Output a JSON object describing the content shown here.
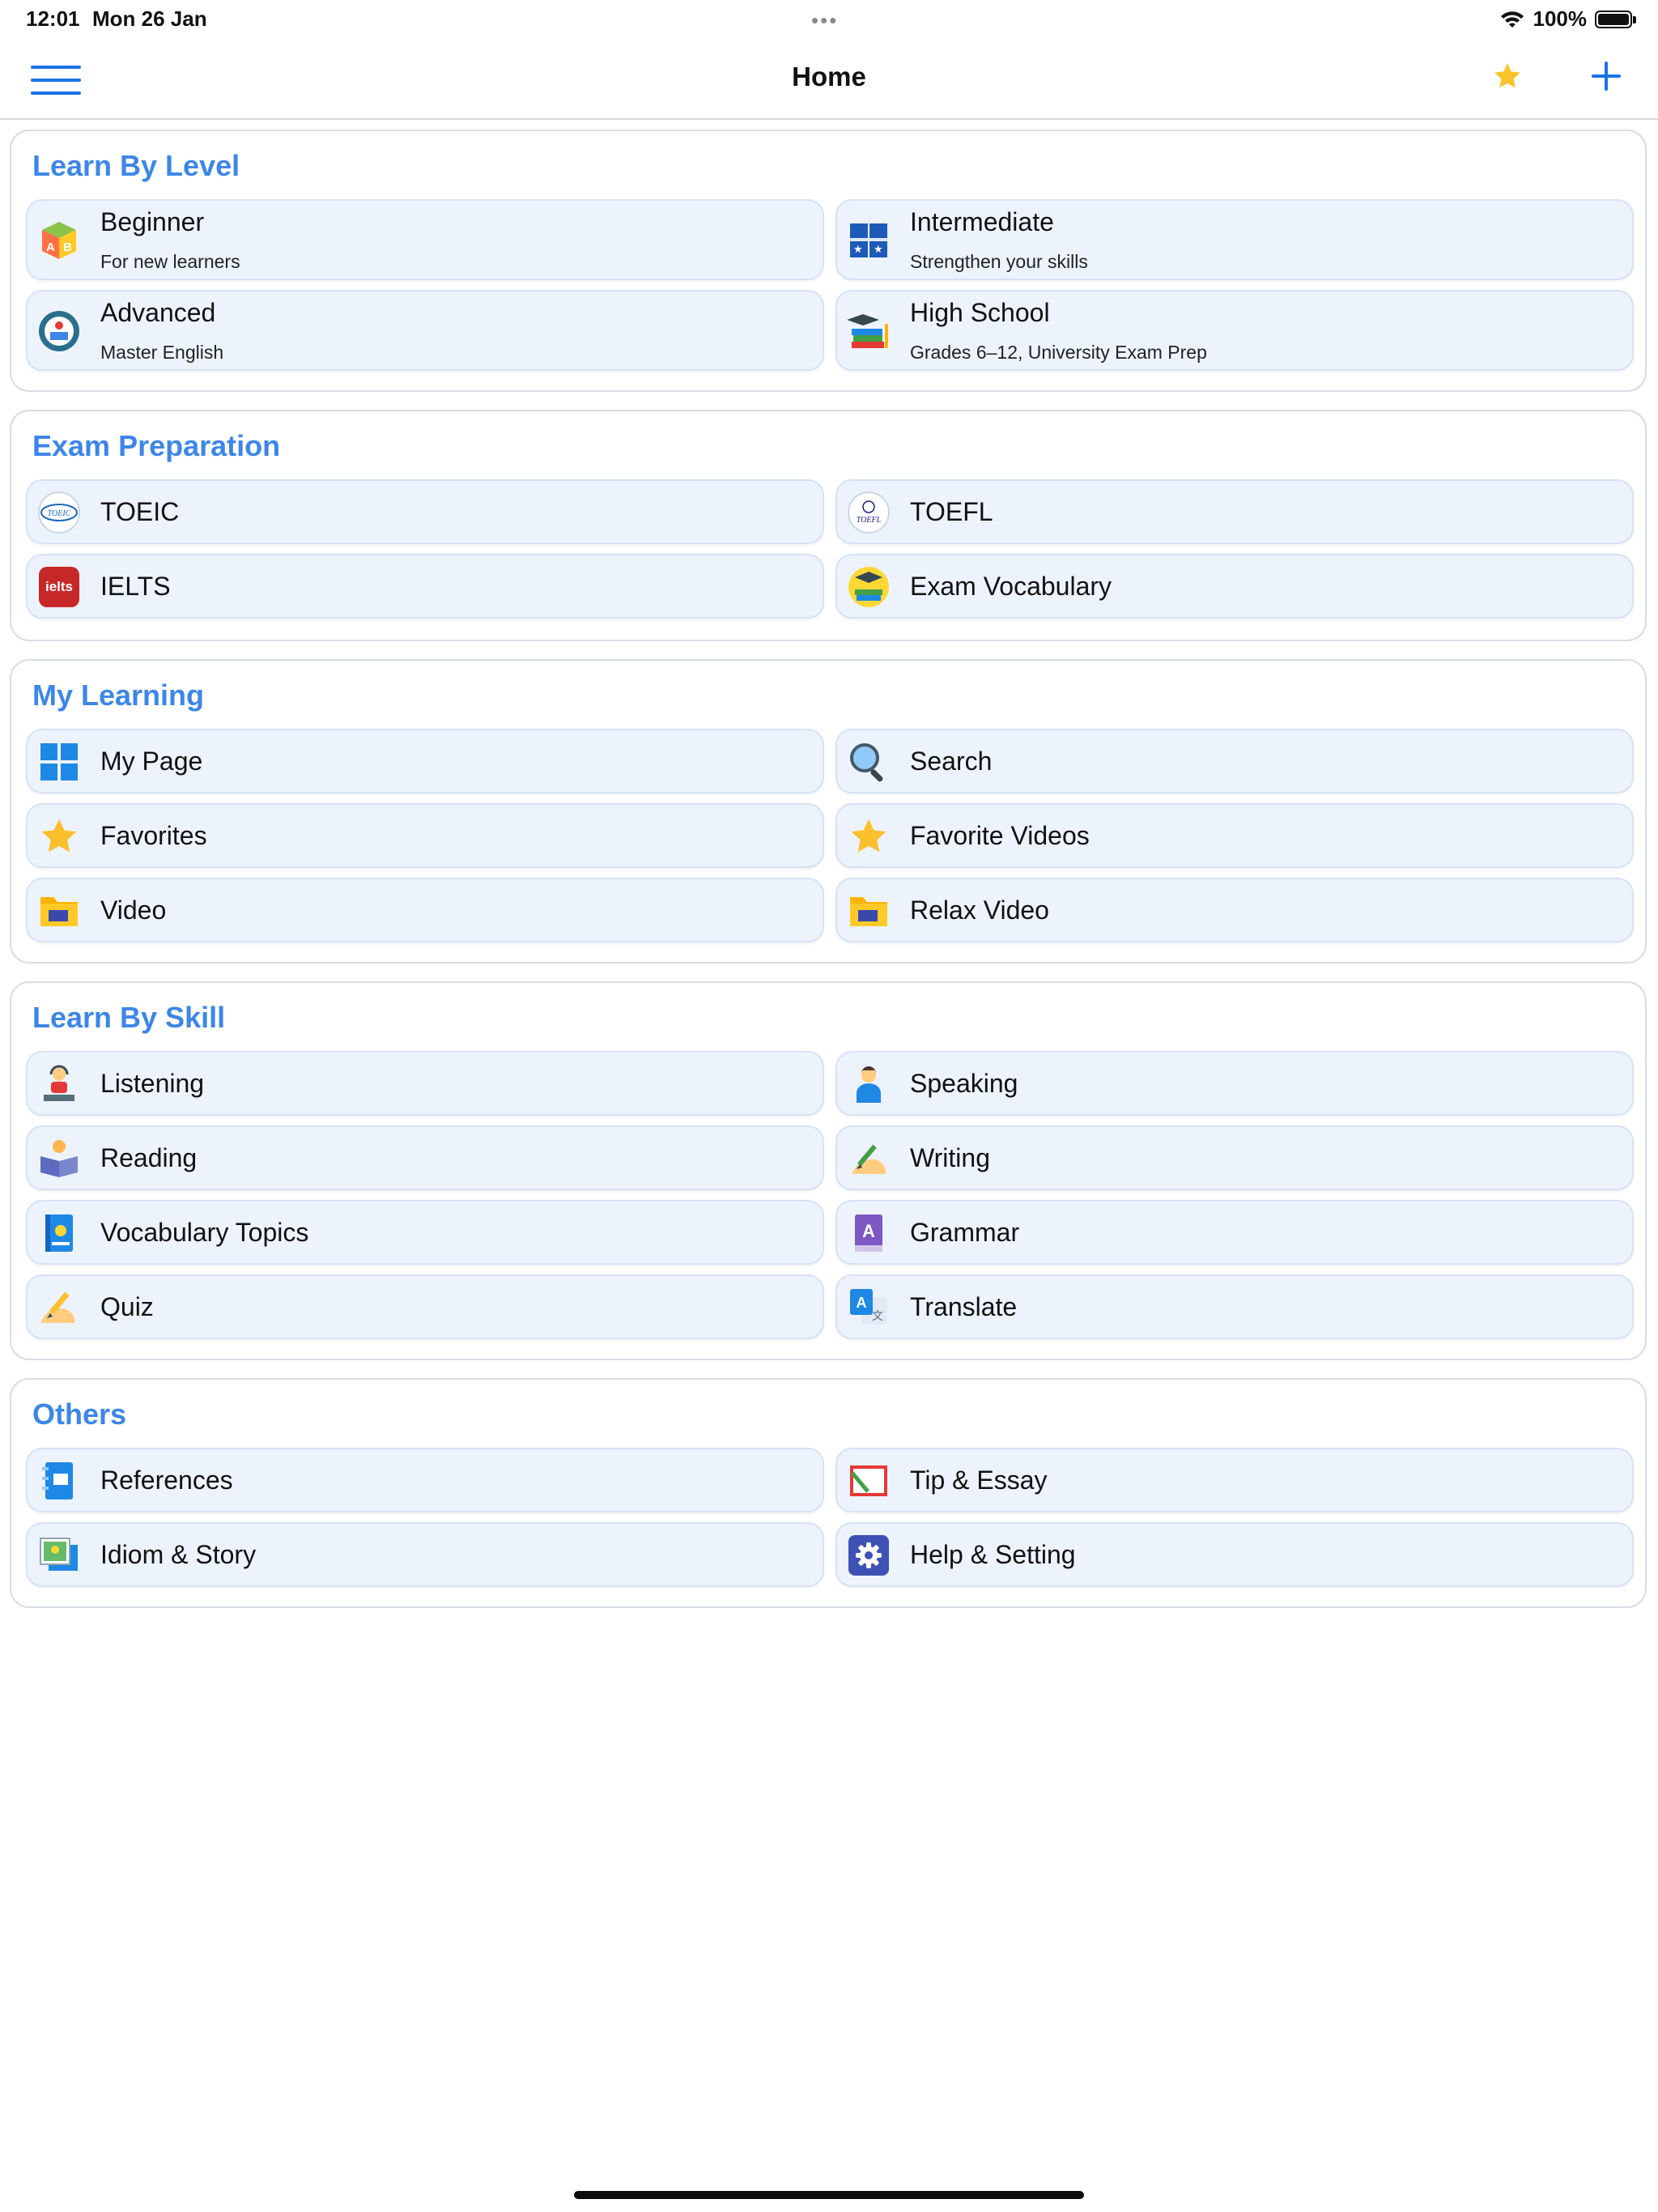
{
  "status": {
    "time": "12:01",
    "date": "Mon 26 Jan",
    "battery": "100%",
    "dots": "•••"
  },
  "nav": {
    "title": "Home",
    "menu_icon": "hamburger-menu-icon",
    "favorites_icon": "star-icon",
    "add_icon": "plus-icon"
  },
  "colors": {
    "accent": "#3d86e8",
    "tile_bg": "#edf3fd",
    "tile_border": "#d6e2f5",
    "star": "#f7c42c"
  },
  "sections": {
    "level": {
      "title": "Learn By Level",
      "items": [
        {
          "label": "Beginner",
          "subtitle": "For new learners",
          "icon": "abc-blocks-icon"
        },
        {
          "label": "Intermediate",
          "subtitle": "Strengthen your skills",
          "icon": "open-book-icon"
        },
        {
          "label": "Advanced",
          "subtitle": "Master English",
          "icon": "globe-badge-icon"
        },
        {
          "label": "High School",
          "subtitle": "Grades 6–12, University Exam Prep",
          "icon": "graduation-books-icon"
        }
      ]
    },
    "exam": {
      "title": "Exam Preparation",
      "items": [
        {
          "label": "TOEIC",
          "icon": "toeic-logo-icon",
          "logo_text": "TOEIC"
        },
        {
          "label": "TOEFL",
          "icon": "toefl-logo-icon",
          "logo_text": "TOEFL"
        },
        {
          "label": "IELTS",
          "icon": "ielts-logo-icon",
          "logo_text": "ielts"
        },
        {
          "label": "Exam Vocabulary",
          "icon": "exam-vocabulary-icon"
        }
      ]
    },
    "my": {
      "title": "My Learning",
      "items": [
        {
          "label": "My Page",
          "icon": "grid-tiles-icon"
        },
        {
          "label": "Search",
          "icon": "magnifier-icon"
        },
        {
          "label": "Favorites",
          "icon": "star-icon"
        },
        {
          "label": "Favorite Videos",
          "icon": "star-icon"
        },
        {
          "label": "Video",
          "icon": "video-folder-icon"
        },
        {
          "label": "Relax Video",
          "icon": "video-folder-icon"
        }
      ]
    },
    "skill": {
      "title": "Learn By Skill",
      "items": [
        {
          "label": "Listening",
          "icon": "headphones-person-icon"
        },
        {
          "label": "Speaking",
          "icon": "speaking-person-icon"
        },
        {
          "label": "Reading",
          "icon": "reading-person-icon"
        },
        {
          "label": "Writing",
          "icon": "writing-hand-icon"
        },
        {
          "label": "Vocabulary Topics",
          "icon": "vocabulary-book-icon"
        },
        {
          "label": "Grammar",
          "icon": "grammar-book-icon"
        },
        {
          "label": "Quiz",
          "icon": "quiz-pencil-icon"
        },
        {
          "label": "Translate",
          "icon": "translate-icon"
        }
      ]
    },
    "others": {
      "title": "Others",
      "items": [
        {
          "label": "References",
          "icon": "references-notebook-icon"
        },
        {
          "label": "Tip & Essay",
          "icon": "essay-notebook-icon"
        },
        {
          "label": "Idiom & Story",
          "icon": "idiom-pictures-icon"
        },
        {
          "label": "Help & Setting",
          "icon": "settings-gear-icon"
        }
      ]
    }
  }
}
